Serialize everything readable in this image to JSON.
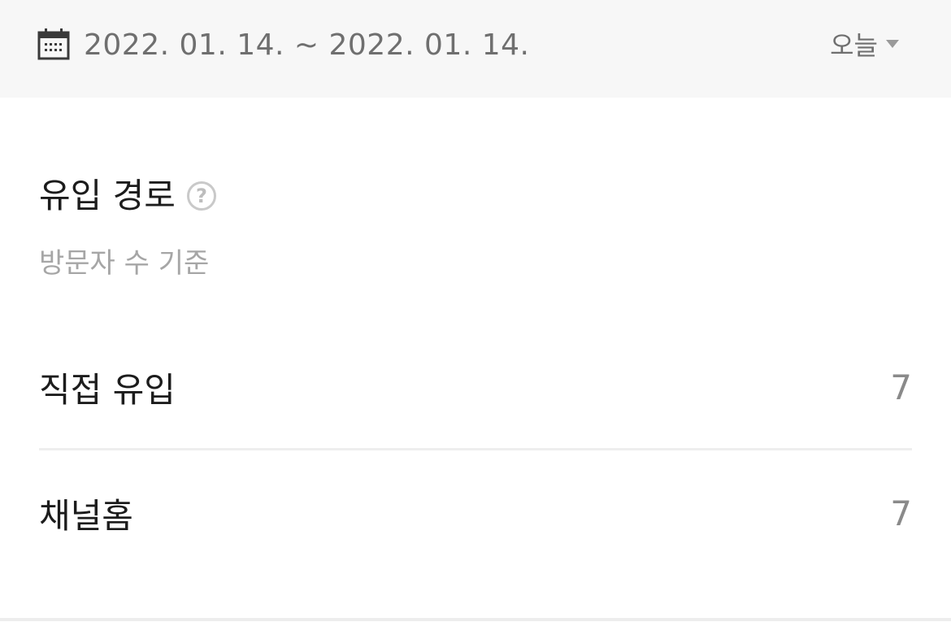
{
  "date_bar": {
    "range": "2022. 01. 14. ~ 2022. 01. 14.",
    "period_selected": "오늘"
  },
  "section": {
    "title": "유입 경로",
    "help_symbol": "?",
    "subtitle": "방문자 수 기준"
  },
  "rows": [
    {
      "label": "직접 유입",
      "value": "7"
    },
    {
      "label": "채널홈",
      "value": "7"
    }
  ]
}
